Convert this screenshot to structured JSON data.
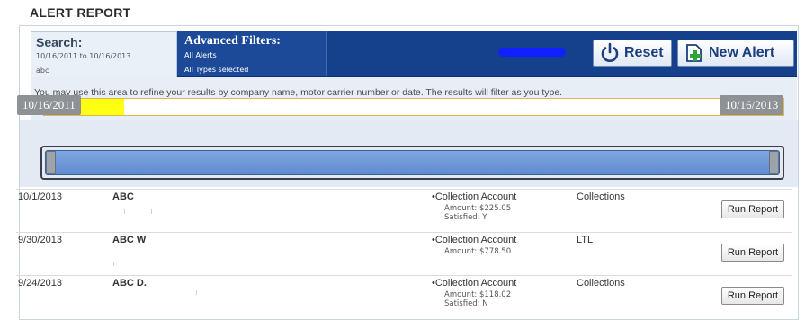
{
  "report_title": "ALERT REPORT",
  "search_tab": {
    "title": "Search:",
    "date_range": "10/16/2011 to 10/16/2013",
    "query": "abc"
  },
  "advanced_tab": {
    "title": "Advanced Filters:",
    "line1": "All Alerts",
    "line2": "All Types selected"
  },
  "toolbar": {
    "reset_label": "Reset",
    "new_alert_label": "New Alert"
  },
  "search": {
    "help_text": "You may use this area to refine your results by company name, motor carrier number or date. The results will filter as you type.",
    "value": "abc"
  },
  "slider": {
    "start_date": "10/16/2011",
    "end_date": "10/16/2013",
    "range": [
      0,
      1
    ]
  },
  "alerts": [
    {
      "date": "10/1/2013",
      "company": "ABC",
      "alert_type": "•Collection Account",
      "detail1": "Amount: $225.05",
      "detail2": "Satisfied: Y",
      "category": "Collections",
      "action": "Run Report"
    },
    {
      "date": "9/30/2013",
      "company": "ABC W",
      "alert_type": "•Collection Account",
      "detail1": "Amount: $778.50",
      "detail2": "",
      "category": "LTL",
      "action": "Run Report"
    },
    {
      "date": "9/24/2013",
      "company": "ABC D.",
      "alert_type": "•Collection Account",
      "detail1": "Amount: $118.02",
      "detail2": "Satisfied: N",
      "category": "Collections",
      "action": "Run Report"
    }
  ],
  "colors": {
    "header_bar": "#15408c",
    "search_tab_bg": "#e9f0f8",
    "slider_fill": "#6f98d8",
    "highlight": "#ffff14"
  },
  "icons": {
    "reset": "power-icon",
    "new_alert": "add-document-icon"
  }
}
